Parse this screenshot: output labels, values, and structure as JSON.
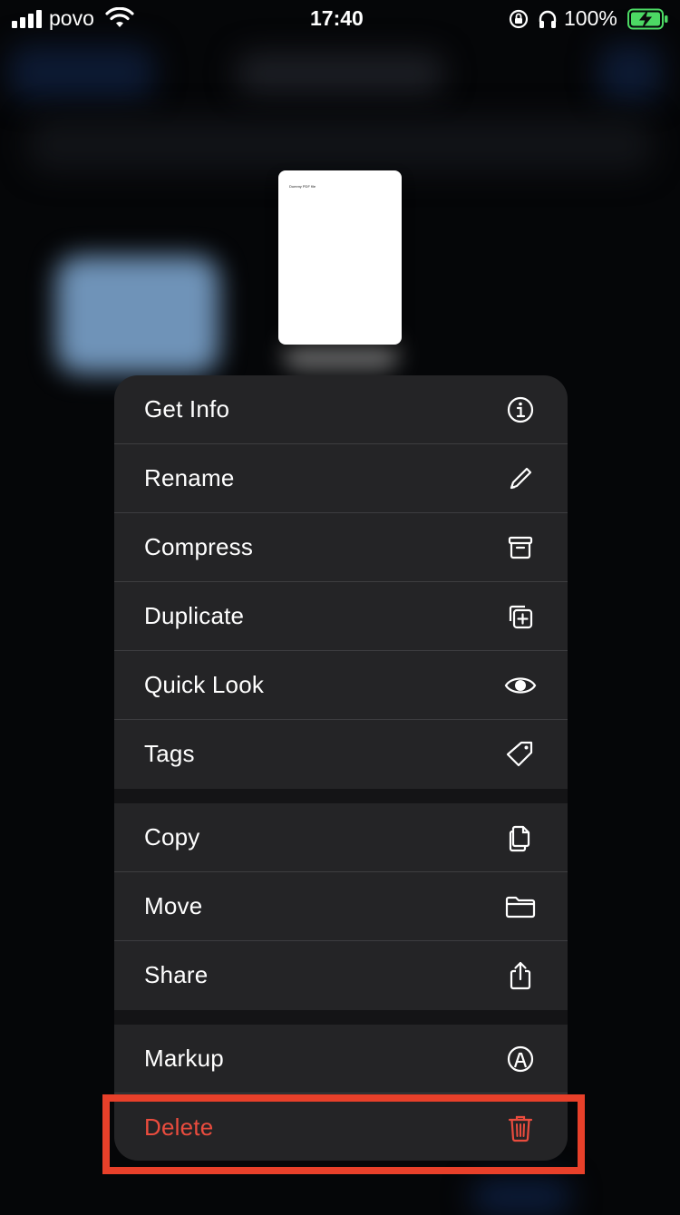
{
  "status_bar": {
    "carrier": "povo",
    "time": "17:40",
    "battery_percent": "100%"
  },
  "preview": {
    "document_title": "Dummy PDF file"
  },
  "menu": {
    "groups": [
      [
        {
          "label": "Get Info",
          "icon": "info-icon"
        },
        {
          "label": "Rename",
          "icon": "pencil-icon"
        },
        {
          "label": "Compress",
          "icon": "archive-box-icon"
        },
        {
          "label": "Duplicate",
          "icon": "duplicate-icon"
        },
        {
          "label": "Quick Look",
          "icon": "eye-icon"
        },
        {
          "label": "Tags",
          "icon": "tag-icon"
        }
      ],
      [
        {
          "label": "Copy",
          "icon": "copy-icon"
        },
        {
          "label": "Move",
          "icon": "folder-icon"
        },
        {
          "label": "Share",
          "icon": "share-icon"
        }
      ],
      [
        {
          "label": "Markup",
          "icon": "markup-icon"
        },
        {
          "label": "Delete",
          "icon": "trash-icon",
          "destructive": true
        }
      ]
    ]
  },
  "colors": {
    "destructive": "#ea4c3e",
    "highlight_box": "#e8402a",
    "battery_charging": "#4cd964"
  }
}
